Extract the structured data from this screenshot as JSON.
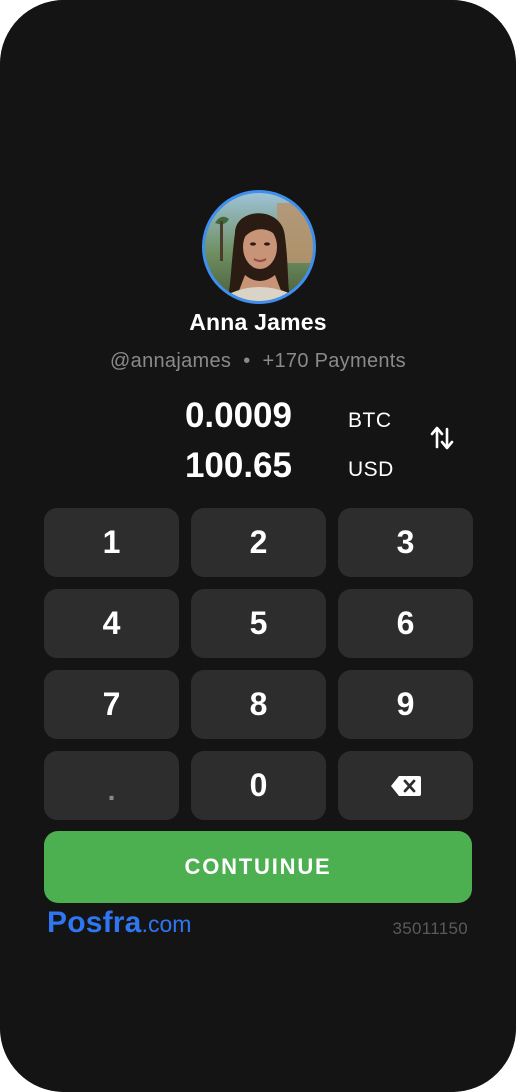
{
  "recipient": {
    "name": "Anna James",
    "handle": "@annajames",
    "separator": "•",
    "payments": "+170 Payments"
  },
  "amounts": {
    "crypto_value": "0.0009",
    "crypto_currency": "BTC",
    "fiat_value": "100.65",
    "fiat_currency": "USD"
  },
  "keypad": {
    "k1": "1",
    "k2": "2",
    "k3": "3",
    "k4": "4",
    "k5": "5",
    "k6": "6",
    "k7": "7",
    "k8": "8",
    "k9": "9",
    "dot": ".",
    "k0": "0"
  },
  "continue_label": "CONTUINUE",
  "brand": {
    "name": "Posfra",
    "tld": ".com",
    "color": "#2f76f2"
  },
  "reference": "35011150",
  "colors": {
    "background": "#141414",
    "key": "#2d2d2d",
    "accent": "#4caf50",
    "avatar_ring": "#3d8ff0"
  },
  "icons": {
    "swap": "swap-vertical-icon",
    "backspace": "backspace-icon"
  }
}
